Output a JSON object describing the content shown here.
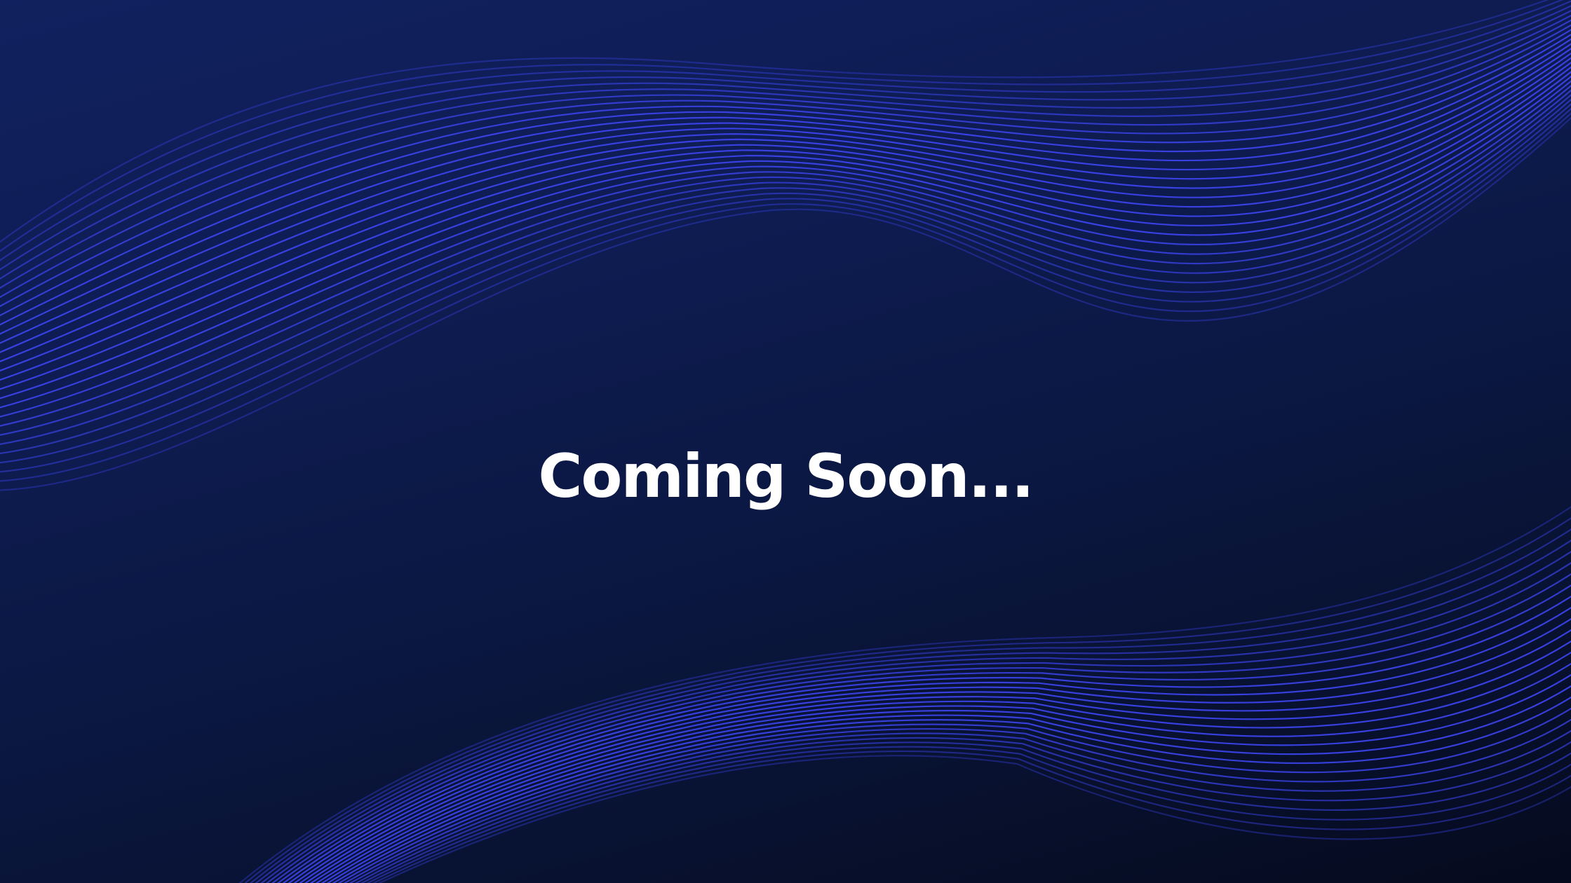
{
  "page": {
    "headline": "Coming Soon..."
  },
  "colors": {
    "background_top": "#11215f",
    "background_bottom": "#050a1d",
    "wave_line": "#3d45f0",
    "headline_text": "#ffffff"
  }
}
